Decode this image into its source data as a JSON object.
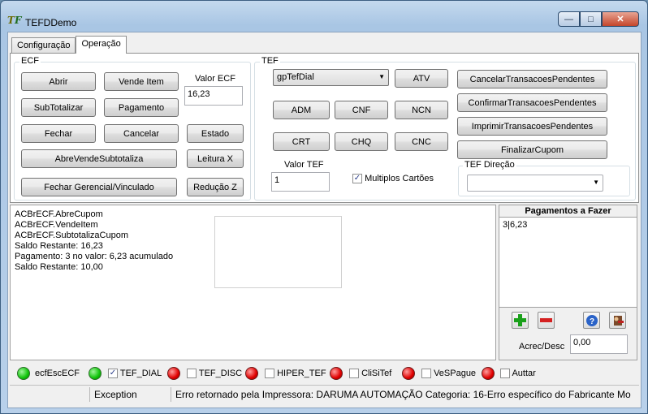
{
  "window": {
    "title": "TEFDDemo",
    "icon": "app-logo-icon"
  },
  "tabs": [
    {
      "label": "Configuração"
    },
    {
      "label": "Operação"
    }
  ],
  "ecf": {
    "group_label": "ECF",
    "buttons": {
      "abrir": "Abrir",
      "vende_item": "Vende Item",
      "subtotalizar": "SubTotalizar",
      "pagamento": "Pagamento",
      "fechar": "Fechar",
      "cancelar": "Cancelar",
      "estado": "Estado",
      "abre_vende_subtotaliza": "AbreVendeSubtotaliza",
      "leitura_x": "Leitura X",
      "fechar_gerencial": "Fechar Gerencial/Vinculado",
      "reducao_z": "Redução Z"
    },
    "valor_ecf_label": "Valor ECF",
    "valor_ecf_value": "16,23"
  },
  "tef": {
    "group_label": "TEF",
    "gp_combo_value": "gpTefDial",
    "buttons": {
      "atv": "ATV",
      "adm": "ADM",
      "cnf": "CNF",
      "ncn": "NCN",
      "crt": "CRT",
      "chq": "CHQ",
      "cnc": "CNC",
      "cancelar_pendentes": "CancelarTransacoesPendentes",
      "confirmar_pendentes": "ConfirmarTransacoesPendentes",
      "imprimir_pendentes": "ImprimirTransacoesPendentes",
      "finalizar_cupom": "FinalizarCupom"
    },
    "valor_tef_label": "Valor TEF",
    "valor_tef_value": "1",
    "multiplos_cartoes_label": "Multiplos Cartões",
    "multiplos_cartoes_checked": true,
    "direcao_label": "TEF Direção",
    "direcao_value": ""
  },
  "log": {
    "lines": [
      "ACBrECF.AbreCupom",
      "ACBrECF.VendeItem",
      "ACBrECF.SubtotalizaCupom",
      "Saldo Restante: 16,23",
      "Pagamento: 3 no valor: 6,23 acumulado",
      "Saldo Restante: 10,00"
    ]
  },
  "pagamentos": {
    "title": "Pagamentos a Fazer",
    "items": [
      "3|6,23"
    ],
    "acrec_desc_label": "Acrec/Desc",
    "acrec_desc_value": "0,00"
  },
  "status_indicators": [
    {
      "label": "ecfEscECF",
      "status": "green",
      "has_checkbox": false,
      "checked": false
    },
    {
      "label": "TEF_DIAL",
      "status": "green",
      "has_checkbox": true,
      "checked": true
    },
    {
      "label": "TEF_DISC",
      "status": "red",
      "has_checkbox": true,
      "checked": false
    },
    {
      "label": "HIPER_TEF",
      "status": "red",
      "has_checkbox": true,
      "checked": false
    },
    {
      "label": "CliSiTef",
      "status": "red",
      "has_checkbox": true,
      "checked": false
    },
    {
      "label": "VeSPague",
      "status": "red",
      "has_checkbox": true,
      "checked": false
    },
    {
      "label": "Auttar",
      "status": "red",
      "has_checkbox": true,
      "checked": false
    }
  ],
  "statusbar": {
    "cell1": "",
    "cell2": "Exception",
    "cell3": "Erro retornado pela Impressora: DARUMA AUTOMAÇÃO  Categoria: 16-Erro específico do Fabricante Mo"
  },
  "colors": {
    "led_green": "#10c40a",
    "led_red": "#e00000"
  }
}
